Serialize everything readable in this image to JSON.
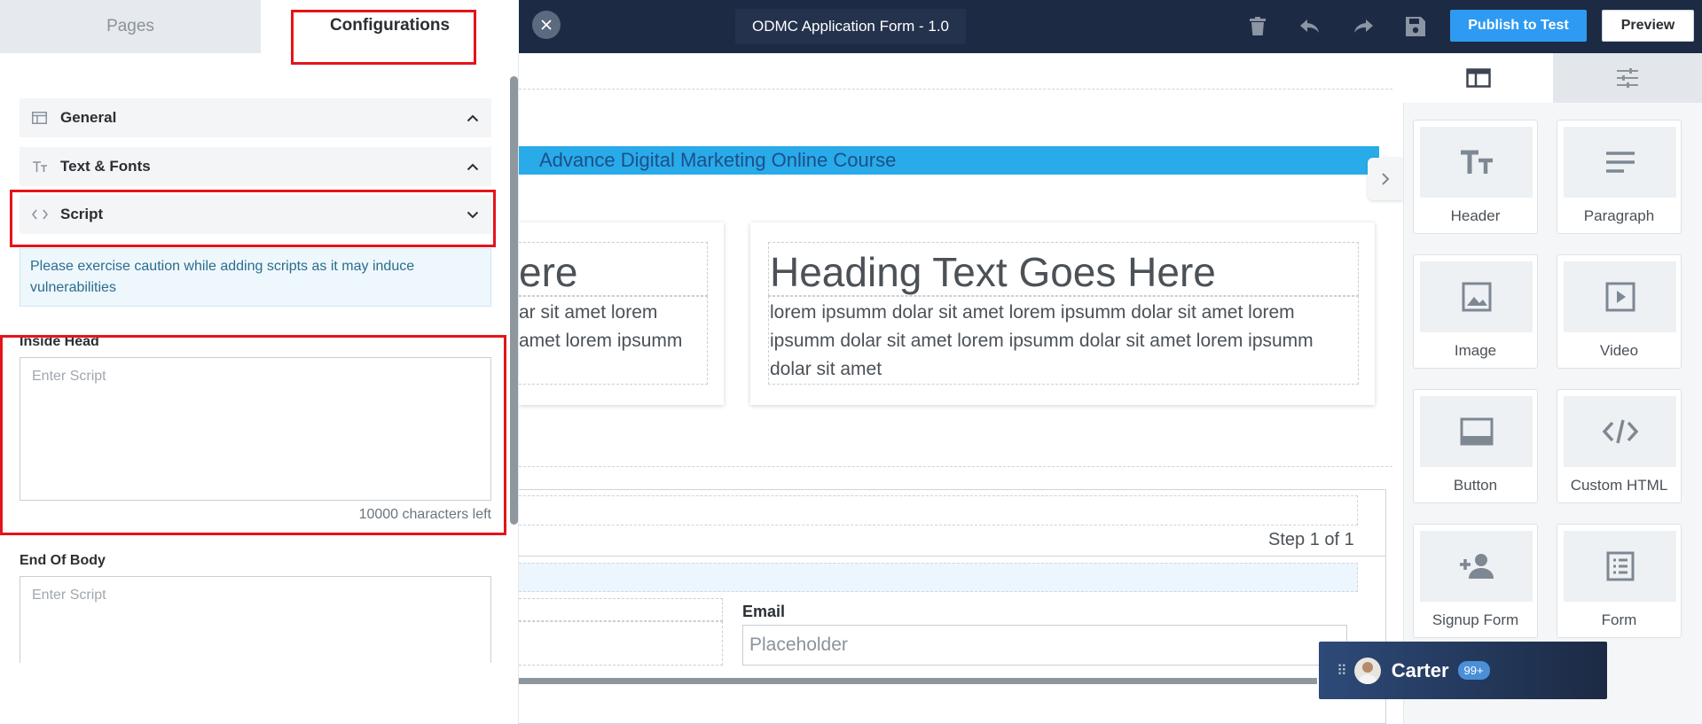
{
  "left_panel": {
    "tabs": {
      "pages": "Pages",
      "configurations": "Configurations"
    },
    "sections": [
      {
        "label": "General",
        "icon": "layout-icon",
        "state": "expanded"
      },
      {
        "label": "Text & Fonts",
        "icon": "text-size-icon",
        "state": "expanded"
      },
      {
        "label": "Script",
        "icon": "code-icon",
        "state": "collapsed"
      }
    ],
    "warning": "Please exercise caution while adding scripts as it may induce vulnerabilities",
    "inside_head": {
      "label": "Inside Head",
      "placeholder": "Enter Script",
      "value": "",
      "chars_left": "10000 characters left"
    },
    "end_of_body": {
      "label": "End Of Body",
      "placeholder": "Enter Script",
      "value": ""
    }
  },
  "topbar": {
    "title": "ODMC Application Form - 1.0",
    "publish_label": "Publish to Test",
    "preview_label": "Preview",
    "icons": [
      "trash-icon",
      "undo-icon",
      "redo-icon",
      "save-icon"
    ]
  },
  "canvas": {
    "banner": "Advance Digital Marketing Online Course",
    "card_left": {
      "heading_fragment": "ere",
      "line1_fragment": "ar sit amet lorem",
      "line2_fragment": "amet lorem ipsumm"
    },
    "card_right": {
      "heading": "Heading Text Goes Here",
      "line1": "lorem ipsumm dolar sit amet lorem ipsumm dolar sit amet lorem",
      "line2": "ipsumm dolar sit amet lorem ipsumm dolar sit amet lorem ipsumm",
      "line3": "dolar sit amet"
    },
    "step": "Step 1 of 1",
    "email_label": "Email",
    "email_placeholder": "Placeholder"
  },
  "right_panel": {
    "widgets": [
      {
        "label": "Header",
        "icon": "text-size-icon"
      },
      {
        "label": "Paragraph",
        "icon": "paragraph-icon"
      },
      {
        "label": "Image",
        "icon": "image-icon"
      },
      {
        "label": "Video",
        "icon": "video-icon"
      },
      {
        "label": "Button",
        "icon": "button-icon"
      },
      {
        "label": "Custom HTML",
        "icon": "code-icon"
      },
      {
        "label": "Signup Form",
        "icon": "add-user-icon"
      },
      {
        "label": "Form",
        "icon": "form-icon"
      }
    ]
  },
  "chat": {
    "name": "Carter",
    "badge": "99+"
  },
  "colors": {
    "topbar": "#1c2a44",
    "accent": "#2f9af1",
    "banner": "#29abe9",
    "highlight": "#e4141b"
  }
}
